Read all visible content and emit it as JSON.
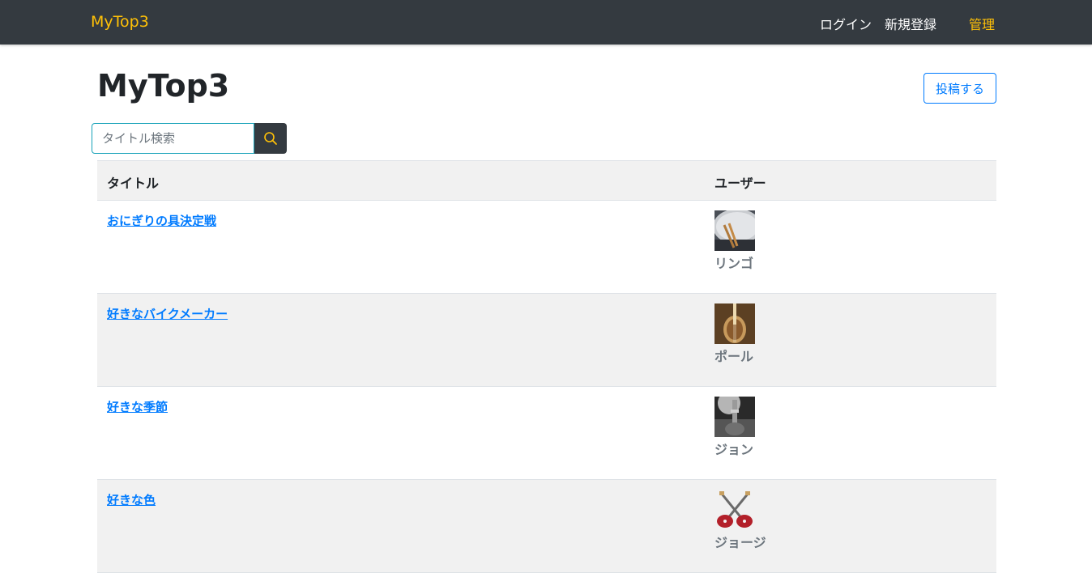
{
  "navbar": {
    "brand": "MyTop3",
    "login": "ログイン",
    "signup": "新規登録",
    "admin": "管理"
  },
  "header": {
    "title": "MyTop3",
    "post_button": "投稿する"
  },
  "search": {
    "placeholder": "タイトル検索"
  },
  "table": {
    "columns": [
      "タイトル",
      "ユーザー"
    ],
    "rows": [
      {
        "title": "おにぎりの具決定戦",
        "user": "リンゴ",
        "avatar_icon": "drum-photo-icon"
      },
      {
        "title": "好きなバイクメーカー",
        "user": "ポール",
        "avatar_icon": "bass-guitar-photo-icon"
      },
      {
        "title": "好きな季節",
        "user": "ジョン",
        "avatar_icon": "guitar-photo-icon"
      },
      {
        "title": "好きな色",
        "user": "ジョージ",
        "avatar_icon": "crossed-guitars-icon"
      }
    ]
  },
  "colors": {
    "navbar_bg": "#343a40",
    "accent": "#ffc107",
    "link": "#007bff",
    "search_border": "#17a2b8"
  }
}
